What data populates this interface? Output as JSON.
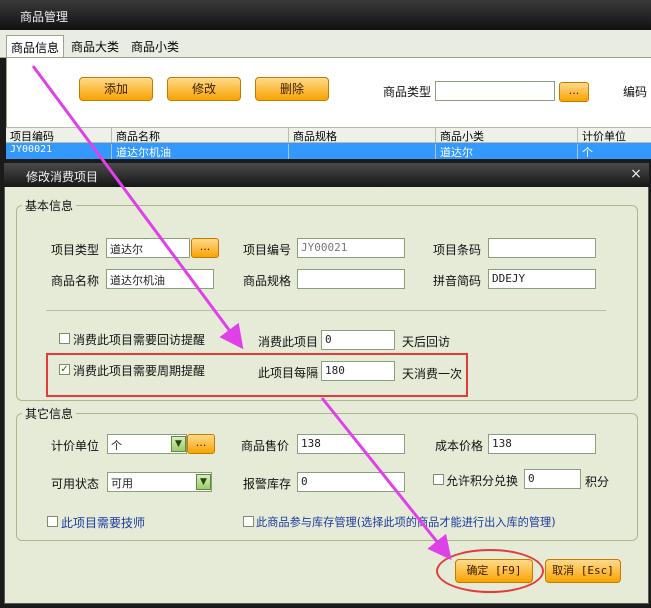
{
  "window": {
    "title": "商品管理"
  },
  "tabs": [
    {
      "label": "商品信息",
      "active": true
    },
    {
      "label": "商品大类",
      "active": false
    },
    {
      "label": "商品小类",
      "active": false
    }
  ],
  "toolbar": {
    "add_label": "添加",
    "edit_label": "修改",
    "delete_label": "删除",
    "type_label": "商品类型",
    "type_value": "",
    "dots_label": "...",
    "code_label": "编码"
  },
  "table": {
    "headers": [
      "项目编码",
      "商品名称",
      "商品规格",
      "商品小类",
      "计价单位"
    ],
    "rows": [
      [
        "JY00021",
        "道达尔机油",
        "",
        "道达尔",
        "个"
      ]
    ]
  },
  "dialog": {
    "title": "修改消费项目",
    "close": "×",
    "basic": {
      "group_title": "基本信息",
      "item_type_label": "项目类型",
      "item_type_value": "道达尔",
      "dots": "...",
      "item_code_label": "项目编号",
      "item_code_value": "JY00021",
      "barcode_label": "项目条码",
      "barcode_value": "",
      "name_label": "商品名称",
      "name_value": "道达尔机油",
      "spec_label": "商品规格",
      "spec_value": "",
      "pinyin_label": "拼音简码",
      "pinyin_value": "DDEJY",
      "revisit_check_label": "消费此项目需要回访提醒",
      "revisit_checked": false,
      "revisit_prefix": "消费此项目",
      "revisit_days": "0",
      "revisit_suffix": "天后回访",
      "period_check_label": "消费此项目需要周期提醒",
      "period_checked": true,
      "period_prefix": "此项目每隔",
      "period_days": "180",
      "period_suffix": "天消费一次"
    },
    "other": {
      "group_title": "其它信息",
      "unit_label": "计价单位",
      "unit_value": "个",
      "dots": "...",
      "price_label": "商品售价",
      "price_value": "138",
      "cost_label": "成本价格",
      "cost_value": "138",
      "status_label": "可用状态",
      "status_value": "可用",
      "alarm_label": "报警库存",
      "alarm_value": "0",
      "points_check_label": "允许积分兑换",
      "points_checked": false,
      "points_value": "0",
      "points_suffix": "积分",
      "tech_check_label": "此项目需要技师",
      "tech_checked": false,
      "stock_check_label": "此商品参与库存管理(选择此项的商品才能进行出入库的管理)",
      "stock_checked": false
    },
    "ok_label": "确定 [F9]",
    "cancel_label": "取消 [Esc]"
  },
  "colors": {
    "annotation_red": "#e53a3a",
    "arrow_magenta": "#e040e8",
    "button_orange": "#f9a400",
    "selection_blue": "#3399ff"
  }
}
